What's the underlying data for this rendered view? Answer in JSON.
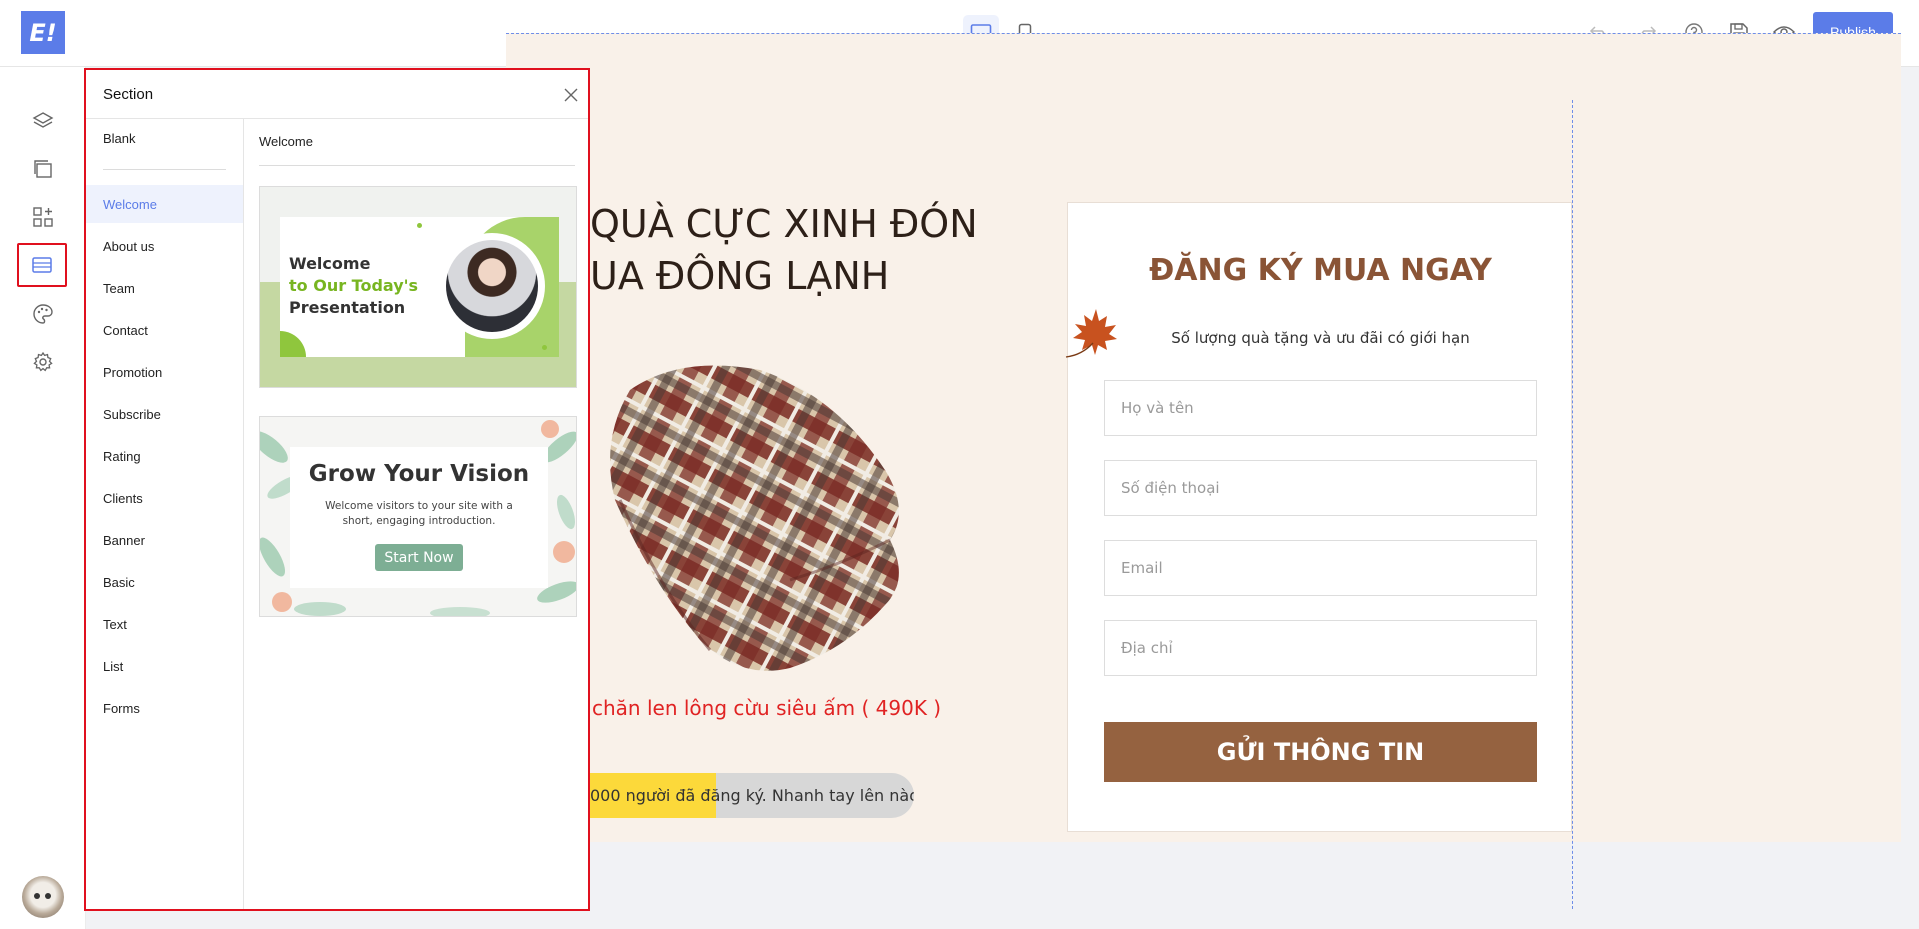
{
  "logo": {
    "text": "E!"
  },
  "toolbar": {
    "publish_label": "Publish"
  },
  "panel": {
    "title": "Section",
    "categories": [
      "Blank",
      "Welcome",
      "About us",
      "Team",
      "Contact",
      "Promotion",
      "Subscribe",
      "Rating",
      "Clients",
      "Banner",
      "Basic",
      "Text",
      "List",
      "Forms"
    ],
    "active_category": "Welcome",
    "preview_title": "Welcome",
    "templates": [
      {
        "line1": "Welcome",
        "line2": "to Our Today's",
        "line3": "Presentation"
      },
      {
        "title": "Grow Your Vision",
        "body1": "Welcome visitors to your site with a",
        "body2": "short, engaging introduction.",
        "button": "Start Now"
      }
    ]
  },
  "canvas": {
    "headline_line1": "QUÀ CỰC XINH ĐÓN",
    "headline_line2": "UA ĐÔNG LẠNH",
    "price_text": "chăn len lông cừu siêu ấm ( 490K )",
    "progress_text_filled": "000 người đã đăng ký.",
    "progress_text_rest": " Nhanh tay lên nào!",
    "progress_percent": 39,
    "form": {
      "title": "ĐĂNG KÝ MUA NGAY",
      "subtitle": "Số lượng quà tặng và ưu đãi có giới hạn",
      "name_placeholder": "Họ và tên",
      "phone_placeholder": "Số điện thoại",
      "email_placeholder": "Email",
      "address_placeholder": "Địa chỉ",
      "submit_label": "GỬI THÔNG TIN"
    }
  },
  "colors": {
    "accent": "#5b7ce8",
    "highlight": "#e0101e",
    "brown": "#956240",
    "progress": "#fcd93a"
  }
}
